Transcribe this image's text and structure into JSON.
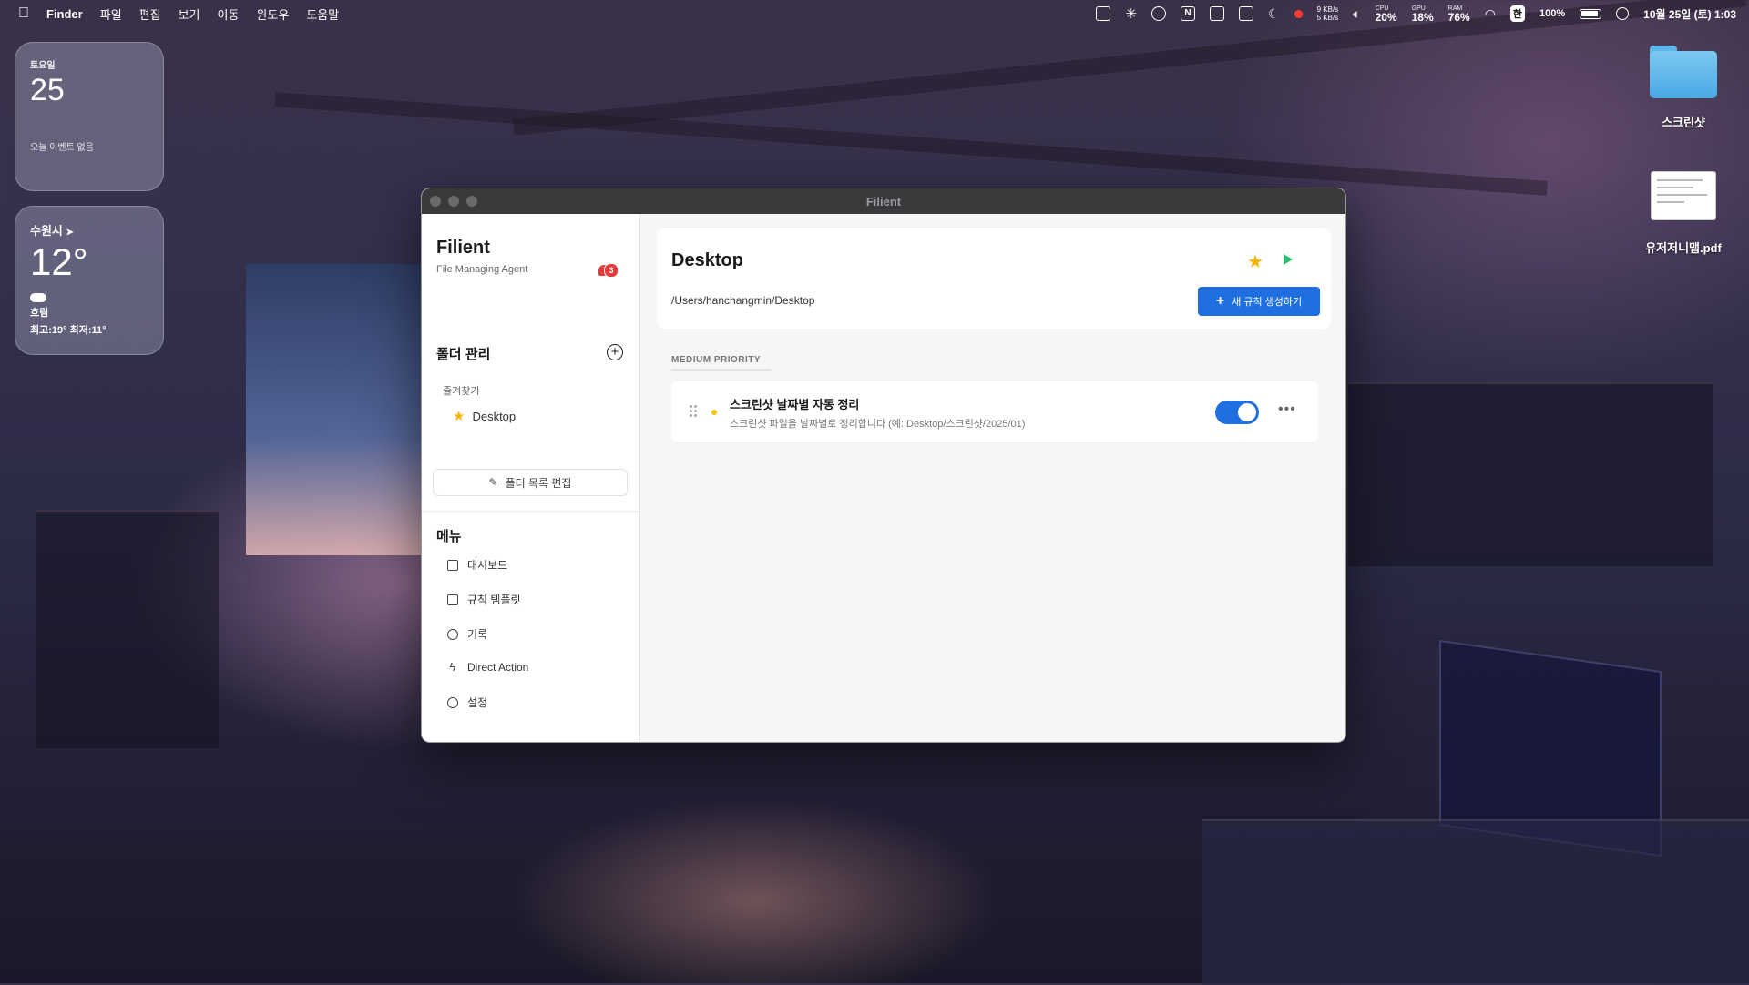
{
  "menubar": {
    "app_name": "Finder",
    "menus": [
      "파일",
      "편집",
      "보기",
      "이동",
      "윈도우",
      "도움말"
    ],
    "net_up": "9 KB/s",
    "net_down": "5 KB/s",
    "cpu_label": "CPU",
    "cpu_value": "20%",
    "gpu_label": "GPU",
    "gpu_value": "18%",
    "ram_label": "RAM",
    "ram_value": "76%",
    "input_method": "한",
    "battery": "100%",
    "datetime": "10월 25일 (토) 1:03"
  },
  "widgets": {
    "calendar": {
      "weekday": "토요일",
      "day": "25",
      "events": "오늘 이벤트 없음"
    },
    "weather": {
      "city": "수원시",
      "temp": "12°",
      "condition": "흐림",
      "high_low": "최고:19° 최저:11°"
    }
  },
  "desktop_icons": [
    {
      "label": "스크린샷",
      "type": "folder-icon"
    },
    {
      "label": "유저저니맵.pdf",
      "type": "pdf-icon"
    }
  ],
  "window": {
    "title": "Filient"
  },
  "sidebar": {
    "brand": "Filient",
    "tagline": "File Managing Agent",
    "notification_count": "3",
    "folders_title": "폴더 관리",
    "favorites_label": "즐겨찾기",
    "favorite_item": "Desktop",
    "edit_folders": "폴더 목록 편집",
    "menu_title": "메뉴",
    "menu": [
      {
        "label": "대시보드",
        "icon": "chart-icon"
      },
      {
        "label": "규칙 템플릿",
        "icon": "template-icon"
      },
      {
        "label": "기록",
        "icon": "history-icon"
      },
      {
        "label": "Direct Action",
        "icon": "bolt-icon"
      },
      {
        "label": "설정",
        "icon": "gear-icon"
      }
    ]
  },
  "main": {
    "folder_name": "Desktop",
    "folder_path": "/Users/hanchangmin/Desktop",
    "new_rule_label": "새 규칙 생성하기",
    "priority_label": "MEDIUM PRIORITY",
    "rules": [
      {
        "name": "스크린샷 날짜별 자동 정리",
        "description": "스크린샷 파일을 날짜별로 정리합니다 (예: Desktop/스크린샷/2025/01)",
        "enabled": true
      }
    ]
  }
}
